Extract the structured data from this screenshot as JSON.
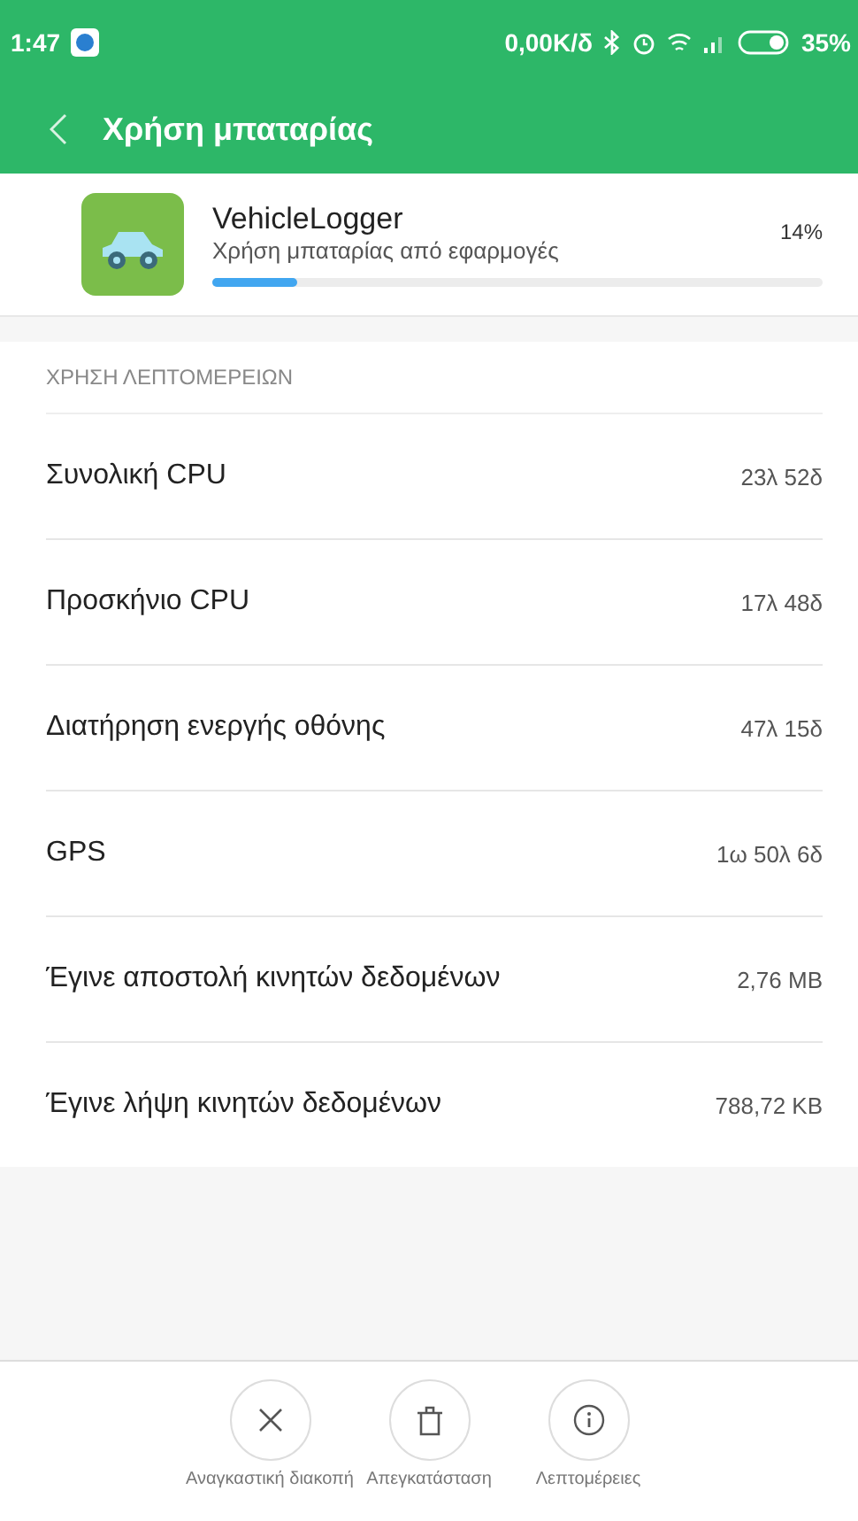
{
  "status_bar": {
    "time": "1:47",
    "speed": "0,00K/δ",
    "battery": "35%"
  },
  "header": {
    "title": "Χρήση μπαταρίας"
  },
  "app": {
    "name": "VehicleLogger",
    "subtitle": "Χρήση μπαταρίας από εφαρμογές",
    "percent": "14%",
    "level": 0.14
  },
  "section": {
    "title": "ΧΡΗΣΗ ΛΕΠΤΟΜΕΡΕΙΩΝ"
  },
  "details": [
    {
      "label": "Συνολική CPU",
      "value": "23λ 52δ"
    },
    {
      "label": "Προσκήνιο CPU",
      "value": "17λ 48δ"
    },
    {
      "label": "Διατήρηση ενεργής οθόνης",
      "value": "47λ 15δ"
    },
    {
      "label": "GPS",
      "value": "1ω 50λ 6δ"
    },
    {
      "label": "Έγινε αποστολή κινητών δεδομένων",
      "value": "2,76 MB"
    },
    {
      "label": "Έγινε λήψη κινητών δεδομένων",
      "value": "788,72 KB"
    }
  ],
  "actions": [
    {
      "kind": "stop",
      "label": "Αναγκαστική διακοπή"
    },
    {
      "kind": "uninstall",
      "label": "Απεγκατάσταση"
    },
    {
      "kind": "info",
      "label": "Λεπτομέρειες"
    }
  ]
}
